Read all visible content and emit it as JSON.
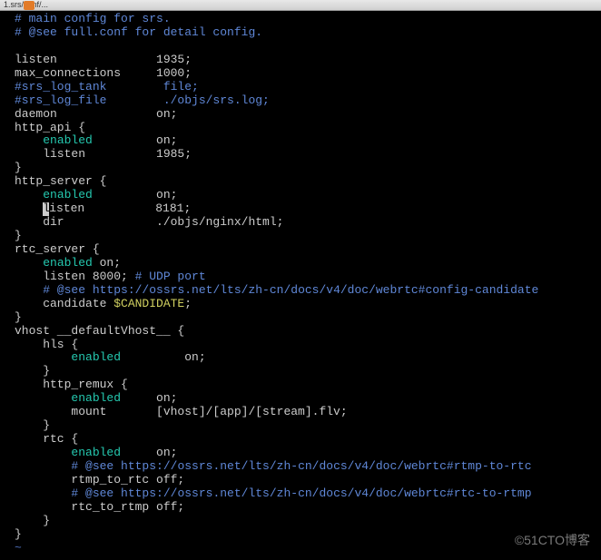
{
  "titlebar": {
    "filename": "1.srs/conf/...",
    "accent_color": "#e27b28"
  },
  "lines": [
    {
      "segs": [
        {
          "t": "# main config for srs.",
          "c": "c-comment"
        }
      ]
    },
    {
      "segs": [
        {
          "t": "# @see full.conf for detail config.",
          "c": "c-comment"
        }
      ]
    },
    {
      "segs": [
        {
          "t": "",
          "c": "c-key"
        }
      ]
    },
    {
      "segs": [
        {
          "t": "listen              1935;",
          "c": "c-key"
        }
      ]
    },
    {
      "segs": [
        {
          "t": "max_connections     1000;",
          "c": "c-key"
        }
      ]
    },
    {
      "segs": [
        {
          "t": "#srs_log_tank        file;",
          "c": "c-comment"
        }
      ]
    },
    {
      "segs": [
        {
          "t": "#srs_log_file        ./objs/srs.log;",
          "c": "c-comment"
        }
      ]
    },
    {
      "segs": [
        {
          "t": "daemon              on;",
          "c": "c-key"
        }
      ]
    },
    {
      "segs": [
        {
          "t": "http_api {",
          "c": "c-key"
        }
      ]
    },
    {
      "segs": [
        {
          "t": "    ",
          "c": "c-key"
        },
        {
          "t": "enabled",
          "c": "c-kw"
        },
        {
          "t": "         on;",
          "c": "c-key"
        }
      ]
    },
    {
      "segs": [
        {
          "t": "    listen          1985;",
          "c": "c-key"
        }
      ]
    },
    {
      "segs": [
        {
          "t": "}",
          "c": "c-key"
        }
      ]
    },
    {
      "segs": [
        {
          "t": "http_server {",
          "c": "c-key"
        }
      ]
    },
    {
      "segs": [
        {
          "t": "    ",
          "c": "c-key"
        },
        {
          "t": "enabled",
          "c": "c-kw"
        },
        {
          "t": "         on;",
          "c": "c-key"
        }
      ]
    },
    {
      "segs": [
        {
          "t": "    ",
          "c": "c-key"
        },
        {
          "t": "l",
          "c": "cursor"
        },
        {
          "t": "isten          8181;",
          "c": "c-key"
        }
      ]
    },
    {
      "segs": [
        {
          "t": "    dir             ./objs/nginx/html;",
          "c": "c-key"
        }
      ]
    },
    {
      "segs": [
        {
          "t": "}",
          "c": "c-key"
        }
      ]
    },
    {
      "segs": [
        {
          "t": "rtc_server {",
          "c": "c-key"
        }
      ]
    },
    {
      "segs": [
        {
          "t": "    ",
          "c": "c-key"
        },
        {
          "t": "enabled",
          "c": "c-kw"
        },
        {
          "t": " on;",
          "c": "c-key"
        }
      ]
    },
    {
      "segs": [
        {
          "t": "    listen 8000; ",
          "c": "c-key"
        },
        {
          "t": "# UDP port",
          "c": "c-comment"
        }
      ]
    },
    {
      "segs": [
        {
          "t": "    ",
          "c": "c-key"
        },
        {
          "t": "# @see https://ossrs.net/lts/zh-cn/docs/v4/doc/webrtc#config-candidate",
          "c": "c-comment"
        }
      ]
    },
    {
      "segs": [
        {
          "t": "    candidate ",
          "c": "c-key"
        },
        {
          "t": "$CANDIDATE",
          "c": "c-var"
        },
        {
          "t": ";",
          "c": "c-key"
        }
      ]
    },
    {
      "segs": [
        {
          "t": "}",
          "c": "c-key"
        }
      ]
    },
    {
      "segs": [
        {
          "t": "vhost __defaultVhost__ {",
          "c": "c-key"
        }
      ]
    },
    {
      "segs": [
        {
          "t": "    hls {",
          "c": "c-key"
        }
      ]
    },
    {
      "segs": [
        {
          "t": "        ",
          "c": "c-key"
        },
        {
          "t": "enabled",
          "c": "c-kw"
        },
        {
          "t": "         on;",
          "c": "c-key"
        }
      ]
    },
    {
      "segs": [
        {
          "t": "    }",
          "c": "c-key"
        }
      ]
    },
    {
      "segs": [
        {
          "t": "    http_remux {",
          "c": "c-key"
        }
      ]
    },
    {
      "segs": [
        {
          "t": "        ",
          "c": "c-key"
        },
        {
          "t": "enabled",
          "c": "c-kw"
        },
        {
          "t": "     on;",
          "c": "c-key"
        }
      ]
    },
    {
      "segs": [
        {
          "t": "        mount       [vhost]/[app]/[stream].flv;",
          "c": "c-key"
        }
      ]
    },
    {
      "segs": [
        {
          "t": "    }",
          "c": "c-key"
        }
      ]
    },
    {
      "segs": [
        {
          "t": "    rtc {",
          "c": "c-key"
        }
      ]
    },
    {
      "segs": [
        {
          "t": "        ",
          "c": "c-key"
        },
        {
          "t": "enabled",
          "c": "c-kw"
        },
        {
          "t": "     on;",
          "c": "c-key"
        }
      ]
    },
    {
      "segs": [
        {
          "t": "        ",
          "c": "c-key"
        },
        {
          "t": "# @see https://ossrs.net/lts/zh-cn/docs/v4/doc/webrtc#rtmp-to-rtc",
          "c": "c-comment"
        }
      ]
    },
    {
      "segs": [
        {
          "t": "        rtmp_to_rtc off;",
          "c": "c-key"
        }
      ]
    },
    {
      "segs": [
        {
          "t": "        ",
          "c": "c-key"
        },
        {
          "t": "# @see https://ossrs.net/lts/zh-cn/docs/v4/doc/webrtc#rtc-to-rtmp",
          "c": "c-comment"
        }
      ]
    },
    {
      "segs": [
        {
          "t": "        rtc_to_rtmp off;",
          "c": "c-key"
        }
      ]
    },
    {
      "segs": [
        {
          "t": "    }",
          "c": "c-key"
        }
      ]
    },
    {
      "segs": [
        {
          "t": "}",
          "c": "c-key"
        }
      ]
    },
    {
      "segs": [
        {
          "t": "~",
          "c": "tilde"
        }
      ]
    }
  ],
  "watermark": "©51CTO博客"
}
